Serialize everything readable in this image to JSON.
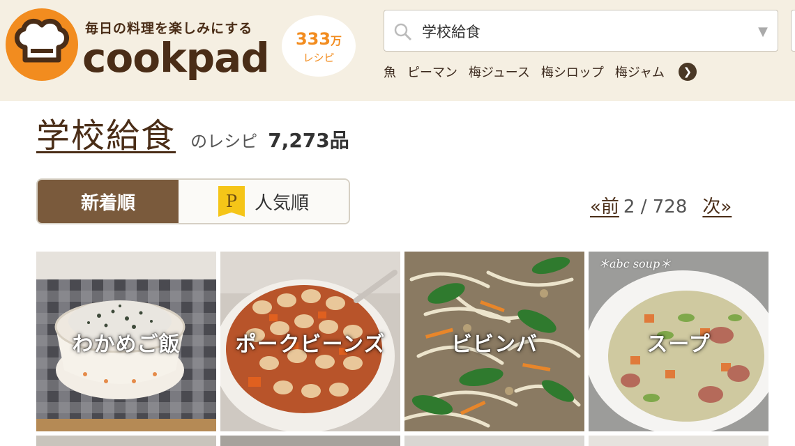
{
  "header": {
    "tagline": "毎日の料理を楽しみにする",
    "brand": "cookpad",
    "recipe_count_number": "333",
    "recipe_count_unit": "万",
    "recipe_count_label": "レシピ",
    "search": {
      "value": "学校給食",
      "placeholder": ""
    },
    "keywords": [
      "魚",
      "ピーマン",
      "梅ジュース",
      "梅シロップ",
      "梅ジャム"
    ],
    "colors": {
      "header_bg": "#f5efe2",
      "logo_orange": "#f28c1f",
      "brand_brown": "#4a2d17"
    }
  },
  "results": {
    "title": "学校給食",
    "suffix": "のレシピ",
    "count": "7,273品"
  },
  "sort": {
    "new_label": "新着順",
    "popular_badge": "P",
    "popular_label": "人気順",
    "active": "新着順"
  },
  "pagination": {
    "prev": "«前",
    "current": "2 / 728",
    "next": "次»"
  },
  "recipes": [
    {
      "label": "わかめご飯",
      "deco": ""
    },
    {
      "label": "ポークビーンズ",
      "deco": ""
    },
    {
      "label": "ビビンバ",
      "deco": ""
    },
    {
      "label": "スープ",
      "deco": "＊abc soup＊"
    }
  ]
}
